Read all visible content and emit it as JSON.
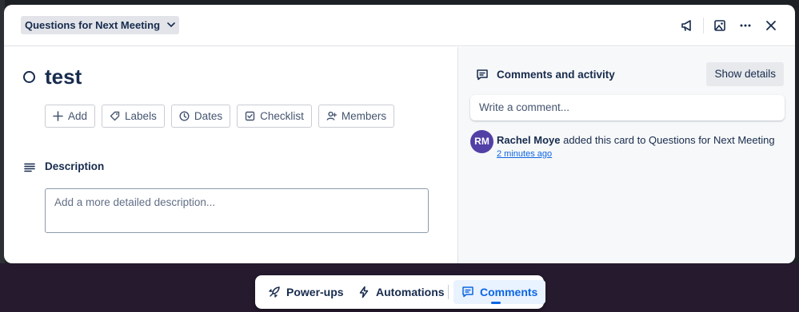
{
  "header": {
    "list_name": "Questions for Next Meeting"
  },
  "card": {
    "title": "test",
    "actions": {
      "add": "Add",
      "labels": "Labels",
      "dates": "Dates",
      "checklist": "Checklist",
      "members": "Members"
    },
    "description": {
      "label": "Description",
      "placeholder": "Add a more detailed description..."
    }
  },
  "activity": {
    "title": "Comments and activity",
    "show_details": "Show details",
    "comment_placeholder": "Write a comment...",
    "entry": {
      "avatar_initials": "RM",
      "user": "Rachel Moye",
      "text": " added this card to Questions for Next Meeting",
      "time": "2 minutes ago"
    }
  },
  "bottom_nav": {
    "powerups": "Power-ups",
    "automations": "Automations",
    "comments": "Comments"
  },
  "colors": {
    "accent": "#0c66e4",
    "avatar": "#5240a6",
    "text": "#172b4d"
  }
}
